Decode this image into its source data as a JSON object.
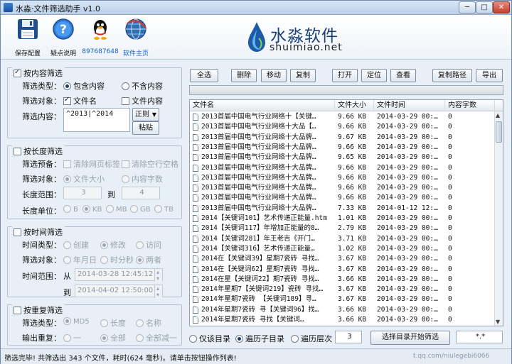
{
  "window": {
    "title": "水淼·文件筛选助手 v1.0",
    "min": "─",
    "max": "□",
    "close": "✕"
  },
  "toolbar": {
    "items": [
      {
        "label": "保存配置",
        "icon": "floppy-disk-icon"
      },
      {
        "label": "疑点说明",
        "icon": "help-icon"
      },
      {
        "label": "897687648",
        "icon": "qq-penguin-icon"
      },
      {
        "label": "软件主页",
        "icon": "globe-icon"
      }
    ]
  },
  "logo": {
    "cn": "水淼软件",
    "en": "shuimiao.net"
  },
  "content_filter": {
    "title": "按内容筛选",
    "checked": true,
    "type_label": "筛选类型：",
    "type_options": [
      "包含内容",
      "不含内容"
    ],
    "object_label": "筛选对象：",
    "object_options": [
      "文件名",
      "文件内容"
    ],
    "content_label": "筛选内容：",
    "content_value": "^2013|^2014",
    "mode_value": "正则",
    "paste_label": "粘贴"
  },
  "length_filter": {
    "title": "按长度筛选",
    "checked": false,
    "preset_label": "筛选预备：",
    "preset_options": [
      "清除网页标签",
      "清除空行空格"
    ],
    "object_label": "筛选对象：",
    "object_options": [
      "文件大小",
      "内容字数"
    ],
    "range_label": "长度范围：",
    "range_from": "3",
    "range_to_label": "到",
    "range_to": "4",
    "unit_label": "长度单位：",
    "unit_options": [
      "B",
      "KB",
      "MB",
      "GB",
      "TB"
    ]
  },
  "time_filter": {
    "title": "按时间筛选",
    "checked": false,
    "type_label": "时间类型：",
    "type_options": [
      "创建",
      "修改",
      "访问"
    ],
    "object_label": "筛选对象：",
    "object_options": [
      "年月日",
      "时分秒",
      "两者"
    ],
    "range_label": "时间范围：",
    "from_label": "从",
    "from_value": "2014-03-28 12:45:12",
    "to_label": "到",
    "to_value": "2014-04-02 12:50:00"
  },
  "dup_filter": {
    "title": "按重复筛选",
    "checked": false,
    "type_label": "筛选类型：",
    "type_options": [
      "MD5",
      "长度",
      "名称"
    ],
    "output_label": "输出重复：",
    "output_options": [
      "一",
      "全部",
      "全部减一"
    ]
  },
  "actions": {
    "select_all": "全选",
    "delete": "删除",
    "move": "移动",
    "copy": "复制",
    "open": "打开",
    "locate": "定位",
    "view": "查看",
    "copy_path": "复制路径",
    "export": "导出"
  },
  "progress": {
    "value": 0
  },
  "table": {
    "columns": [
      "文件名",
      "文件大小",
      "文件时间",
      "内容字数"
    ],
    "rows": [
      [
        "2013首届中国电气行业网络十【关键…",
        "9.66 KB",
        "2014-03-29 00:…",
        "0"
      ],
      [
        "2013首届中国电气行业网络十大品【…",
        "9.66 KB",
        "2014-03-29 00:…",
        "0"
      ],
      [
        "2013首届中国电气行业网络十大品牌…",
        "9.67 KB",
        "2014-03-29 00:…",
        "0"
      ],
      [
        "2013首届中国电气行业网络十大品牌…",
        "9.66 KB",
        "2014-03-29 00:…",
        "0"
      ],
      [
        "2013首届中国电气行业网络十大品牌…",
        "9.65 KB",
        "2014-03-29 00:…",
        "0"
      ],
      [
        "2013首届中国电气行业网络十大品牌…",
        "9.66 KB",
        "2014-03-29 00:…",
        "0"
      ],
      [
        "2013首届中国电气行业网络十大品牌…",
        "9.66 KB",
        "2014-03-29 00:…",
        "0"
      ],
      [
        "2013首届中国电气行业网络十大品牌…",
        "9.66 KB",
        "2014-03-29 00:…",
        "0"
      ],
      [
        "2013首届中国电气行业网络十大品牌…",
        "9.66 KB",
        "2014-03-29 00:…",
        "0"
      ],
      [
        "2013首届中国电气行业网络十大品牌…",
        "7.33 KB",
        "2014-01-12 12:…",
        "0"
      ],
      [
        "2014【关键词101】艺术传递正能量.htm",
        "1.01 KB",
        "2014-03-29 00:…",
        "0"
      ],
      [
        "2014【关键词117】年增加正能量的8…",
        "2.79 KB",
        "2014-03-29 00:…",
        "0"
      ],
      [
        "2014【关键词281】年王老吉《开门…",
        "3.71 KB",
        "2014-03-29 00:…",
        "0"
      ],
      [
        "2014【关键词316】艺术传递正能量…",
        "1.02 KB",
        "2014-03-29 00:…",
        "0"
      ],
      [
        "2014在【关键词39】星期7瓷砖 寻找…",
        "3.67 KB",
        "2014-03-29 00:…",
        "0"
      ],
      [
        "2014在【关键词62】星期7瓷砖 寻找…",
        "3.67 KB",
        "2014-03-29 00:…",
        "0"
      ],
      [
        "2014在星【关键词22】期7瓷砖 寻找…",
        "3.66 KB",
        "2014-03-29 00:…",
        "0"
      ],
      [
        "2014年星期7【关键词219】瓷砖 寻找…",
        "3.67 KB",
        "2014-03-29 00:…",
        "0"
      ],
      [
        "2014年星期7瓷砖 【关键词189】寻…",
        "3.67 KB",
        "2014-03-29 00:…",
        "0"
      ],
      [
        "2014年星期7瓷砖 寻【关键词96】找…",
        "3.66 KB",
        "2014-03-29 00:…",
        "0"
      ],
      [
        "2014年星期7瓷砖 寻找【关键词…",
        "3.66 KB",
        "2014-03-29 00:…",
        "0"
      ]
    ]
  },
  "bottom": {
    "options": [
      "仅该目录",
      "遍历子目录",
      "遍历层次"
    ],
    "depth": "3",
    "start_button": "选择目录开始筛选",
    "pattern": "*.*"
  },
  "status": {
    "text": "筛选完毕! 共筛选出 343 个文件，耗时(624 毫秒)。请单击按钮操作列表!",
    "url": "t.qq.com/niulegebi6066"
  }
}
